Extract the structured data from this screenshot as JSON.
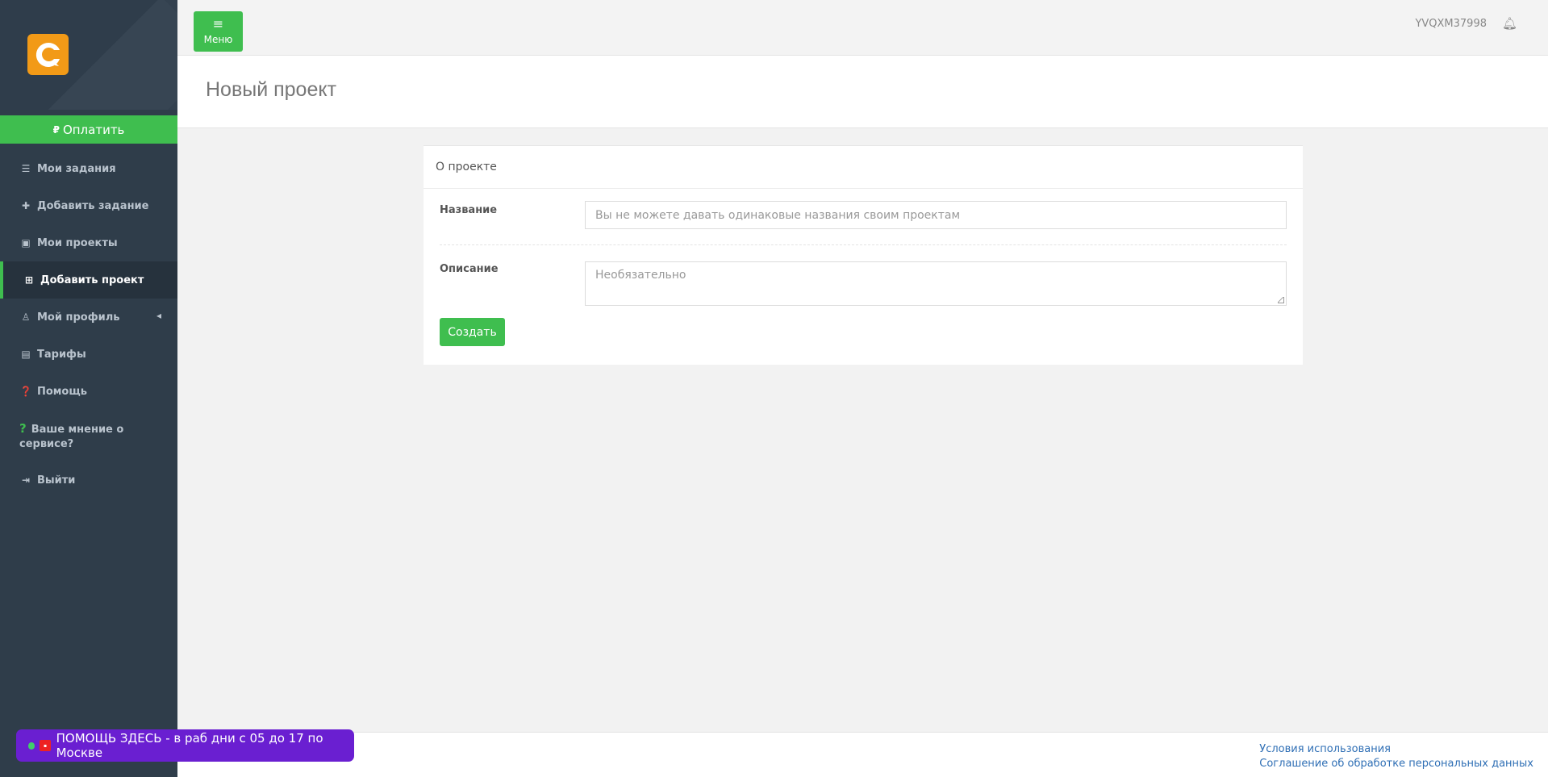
{
  "sidebar": {
    "pay_label": "Оплатить",
    "items": [
      {
        "label": "Мои задания",
        "icon": "list-icon"
      },
      {
        "label": "Добавить задание",
        "icon": "plus-icon"
      },
      {
        "label": "Мои проекты",
        "icon": "briefcase-icon"
      },
      {
        "label": "Добавить проект",
        "icon": "plus-square-icon"
      },
      {
        "label": "Мой профиль",
        "icon": "user-icon"
      },
      {
        "label": "Тарифы",
        "icon": "credit-card-icon"
      },
      {
        "label": "Помощь",
        "icon": "question-circle-icon"
      },
      {
        "label": "Ваше мнение о сервисе?",
        "icon": "question-icon"
      },
      {
        "label": "Выйти",
        "icon": "sign-out-icon"
      }
    ]
  },
  "header": {
    "menu_label": "Меню",
    "username": "YVQXM37998"
  },
  "page": {
    "title": "Новый проект"
  },
  "form": {
    "section_title": "О проекте",
    "name_label": "Название",
    "name_placeholder": "Вы не можете давать одинаковые названия своим проектам",
    "description_label": "Описание",
    "description_placeholder": "Необязательно",
    "submit_label": "Создать"
  },
  "footer": {
    "terms_link": "Условия использования",
    "privacy_link": "Соглашение об обработке персональных данных"
  },
  "help_chip": {
    "text": "ПОМОЩЬ ЗДЕСЬ - в раб дни с 05 до 17 по Москве"
  },
  "colors": {
    "accent": "#3fbe4f",
    "sidebar_bg": "#2f3d4a",
    "logo_bg": "#f29a17",
    "help_chip_bg": "#6a1fd1",
    "link": "#2f6fb5"
  }
}
